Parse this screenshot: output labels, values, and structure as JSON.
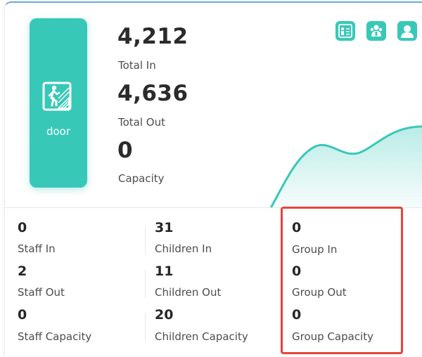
{
  "door": {
    "label": "door",
    "icon": "door-walk-icon"
  },
  "totals": {
    "in_value": "4,212",
    "in_label": "Total In",
    "out_value": "4,636",
    "out_label": "Total Out",
    "capacity_value": "0",
    "capacity_label": "Capacity"
  },
  "header_icons": [
    "staff-badge-icon",
    "group-people-icon",
    "person-icon"
  ],
  "stats": {
    "staff": [
      {
        "value": "0",
        "label": "Staff In"
      },
      {
        "value": "2",
        "label": "Staff Out"
      },
      {
        "value": "0",
        "label": "Staff Capacity"
      }
    ],
    "children": [
      {
        "value": "31",
        "label": "Children In"
      },
      {
        "value": "11",
        "label": "Children Out"
      },
      {
        "value": "20",
        "label": "Children Capacity"
      }
    ],
    "group": [
      {
        "value": "0",
        "label": "Group In"
      },
      {
        "value": "0",
        "label": "Group Out"
      },
      {
        "value": "0",
        "label": "Group Capacity"
      }
    ]
  },
  "colors": {
    "accent": "#38c8b8",
    "highlight": "#e8433d",
    "text": "#262626"
  }
}
